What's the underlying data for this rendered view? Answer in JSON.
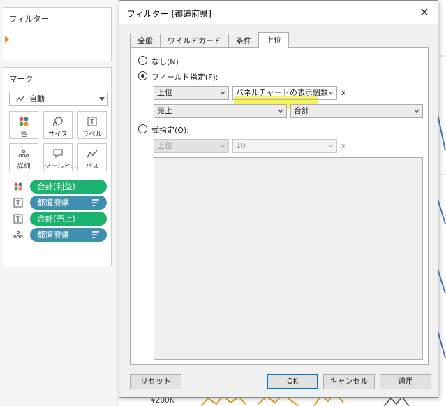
{
  "left_panel": {
    "filters_title": "フィルター",
    "marks_title": "マーク",
    "mark_type": {
      "label": "自動",
      "icon": "line-chart-icon"
    },
    "mark_buttons": [
      {
        "label": "色",
        "icon": "color-dots-icon"
      },
      {
        "label": "サイズ",
        "icon": "size-icon"
      },
      {
        "label": "ラベル",
        "icon": "label-icon"
      },
      {
        "label": "詳細",
        "icon": "detail-icon"
      },
      {
        "label": "ツールヒ...",
        "icon": "tooltip-icon"
      },
      {
        "label": "パス",
        "icon": "path-icon"
      }
    ],
    "pills": [
      {
        "label": "合計(利益)",
        "color": "#19b36f",
        "icon": "color-dots-icon"
      },
      {
        "label": "都道府県",
        "color": "#3e8fb0",
        "icon": "label-icon"
      },
      {
        "label": "合計(売上)",
        "color": "#19b36f",
        "icon": "label-icon"
      },
      {
        "label": "都道府県",
        "color": "#3e8fb0",
        "icon": "detail-icon"
      }
    ]
  },
  "background": {
    "axis_label": "¥200K"
  },
  "dialog": {
    "title": "フィルター [都道府県]",
    "tabs": [
      "全般",
      "ワイルドカード",
      "条件",
      "上位"
    ],
    "active_tab": "上位",
    "options": {
      "none_label": "なし(N)",
      "by_field_label": "フィールド指定(F):",
      "formula_label": "式指定(O):"
    },
    "by_field": {
      "top_bottom": "上位",
      "count": "パネルチャートの表示個数",
      "x": "x",
      "field": "売上",
      "aggregation": "合計"
    },
    "by_formula": {
      "top_bottom": "上位",
      "count": "10",
      "x": "x"
    },
    "buttons": {
      "reset": "リセット",
      "ok": "OK",
      "cancel": "キャンセル",
      "apply": "適用"
    },
    "highlight_color": "#f2ef3e"
  }
}
